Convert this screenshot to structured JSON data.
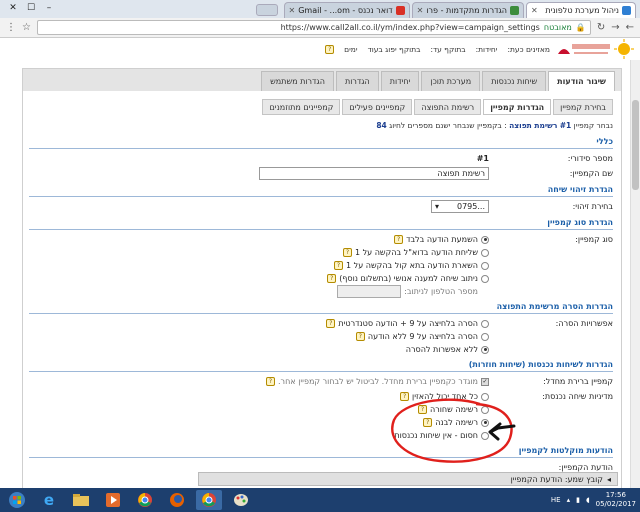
{
  "browser": {
    "tabs": [
      {
        "title": "ניהול מערכת טלפונית",
        "active": true,
        "fav_color": "#2f7fd3"
      },
      {
        "title": "הגדרות מתקדמות - פרו",
        "active": false,
        "fav_color": "#3c8d3c"
      },
      {
        "title": "דואר נכנס - Gmail - ...om",
        "active": false,
        "fav_color": "#d93025"
      }
    ],
    "secure_label": "מאובטח",
    "url": "https://www.call2all.co.il/ym/index.php?view=campaign_settings"
  },
  "infobar": {
    "units_label": "יחידות:",
    "expiry_label": "בתוקף עד:",
    "remaining_text": "בתוקף יפוג בעוד",
    "days_text": "ימים",
    "time_label": "מאזינים כעת:"
  },
  "main_tabs": [
    "שיגור הודעות",
    "שיחות נכנסות",
    "מערכת תוכן",
    "יחידות",
    "הגדרות",
    "הגדרות משתמש"
  ],
  "sub_tabs": [
    "בחירת קמפיין",
    "הגדרות קמפיין",
    "רשימת התפוצה",
    "קמפיינים פעילים",
    "קמפיינים מתוזמנים"
  ],
  "breadcrumb": {
    "prefix": "נבחר קמפיין",
    "number": "#1",
    "name": "רשימת תפוצה",
    "suffix": ": בקמפיין שנבחר ישנם מספרים לחיוג",
    "count": "84"
  },
  "sections": {
    "general": "כללי",
    "caller_id": "הגדרת זיהוי שיחה",
    "campaign_type": "הגדרת סוג קמפיין",
    "removal": "הגדרות הסרה מרשימת התפוצה",
    "incoming": "הגדרות לשיחות נכנסות (שיחות חוזרות)",
    "messages": "הודעות מוקלטות לקמפיין"
  },
  "fields": {
    "serial_label": "מספר סידורי:",
    "serial_value": "#1",
    "name_label": "שם הקמפיין:",
    "name_value": "רשימת תפוצה",
    "caller_label": "בחירת זיהוי:",
    "caller_value": "0795...",
    "type_label": "סוג קמפיין:",
    "type_options": [
      {
        "label": "השמעת הודעה בלבד",
        "checked": true
      },
      {
        "label": "שליחת הודעה בדוא\"ל בהקשה על 1",
        "checked": false
      },
      {
        "label": "השארת הודעה בתא קול בהקשה על 1",
        "checked": false
      },
      {
        "label": "ניתוב שיחה למענה אנושי (בתשלום נוסף)",
        "checked": false
      }
    ],
    "transfer_phone_label": "מספר הטלפון לניתוב:",
    "removal_label": "אפשרויות הסרה:",
    "removal_options": [
      {
        "label": "הסרה בלחיצה על 9 + הודעה סטנדרטית",
        "checked": false
      },
      {
        "label": "הסרה בלחיצה על 9 ללא הודעה",
        "checked": false
      },
      {
        "label": "ללא אפשרות להסרה",
        "checked": true
      }
    ],
    "default_campaign_label": "קמפיין ברירת מחדל:",
    "default_campaign_text": "מוגדר כקמפיין ברירת מחדל. לביטול יש לבחור קמפיין אחר.",
    "policy_label": "מדיניות שיחה נכנסת:",
    "policy_options": [
      {
        "label": "כל אחד יכול להאזין",
        "checked": false
      },
      {
        "label": "רשימה שחורה",
        "checked": false
      },
      {
        "label": "רשימה לבנה",
        "checked": true
      },
      {
        "label": "חסום - אין שיחות נכנסות",
        "checked": false
      }
    ],
    "campaign_message_label": "הודעת הקמפיין:",
    "file_name_text": "קובץ שמע: הודעת הקמפיין"
  },
  "taskbar": {
    "lang": "HE",
    "time": "17:56",
    "date": "05/02/2017"
  },
  "annotation": {
    "circle_color": "#e0201c",
    "arrow_color": "#111111"
  }
}
